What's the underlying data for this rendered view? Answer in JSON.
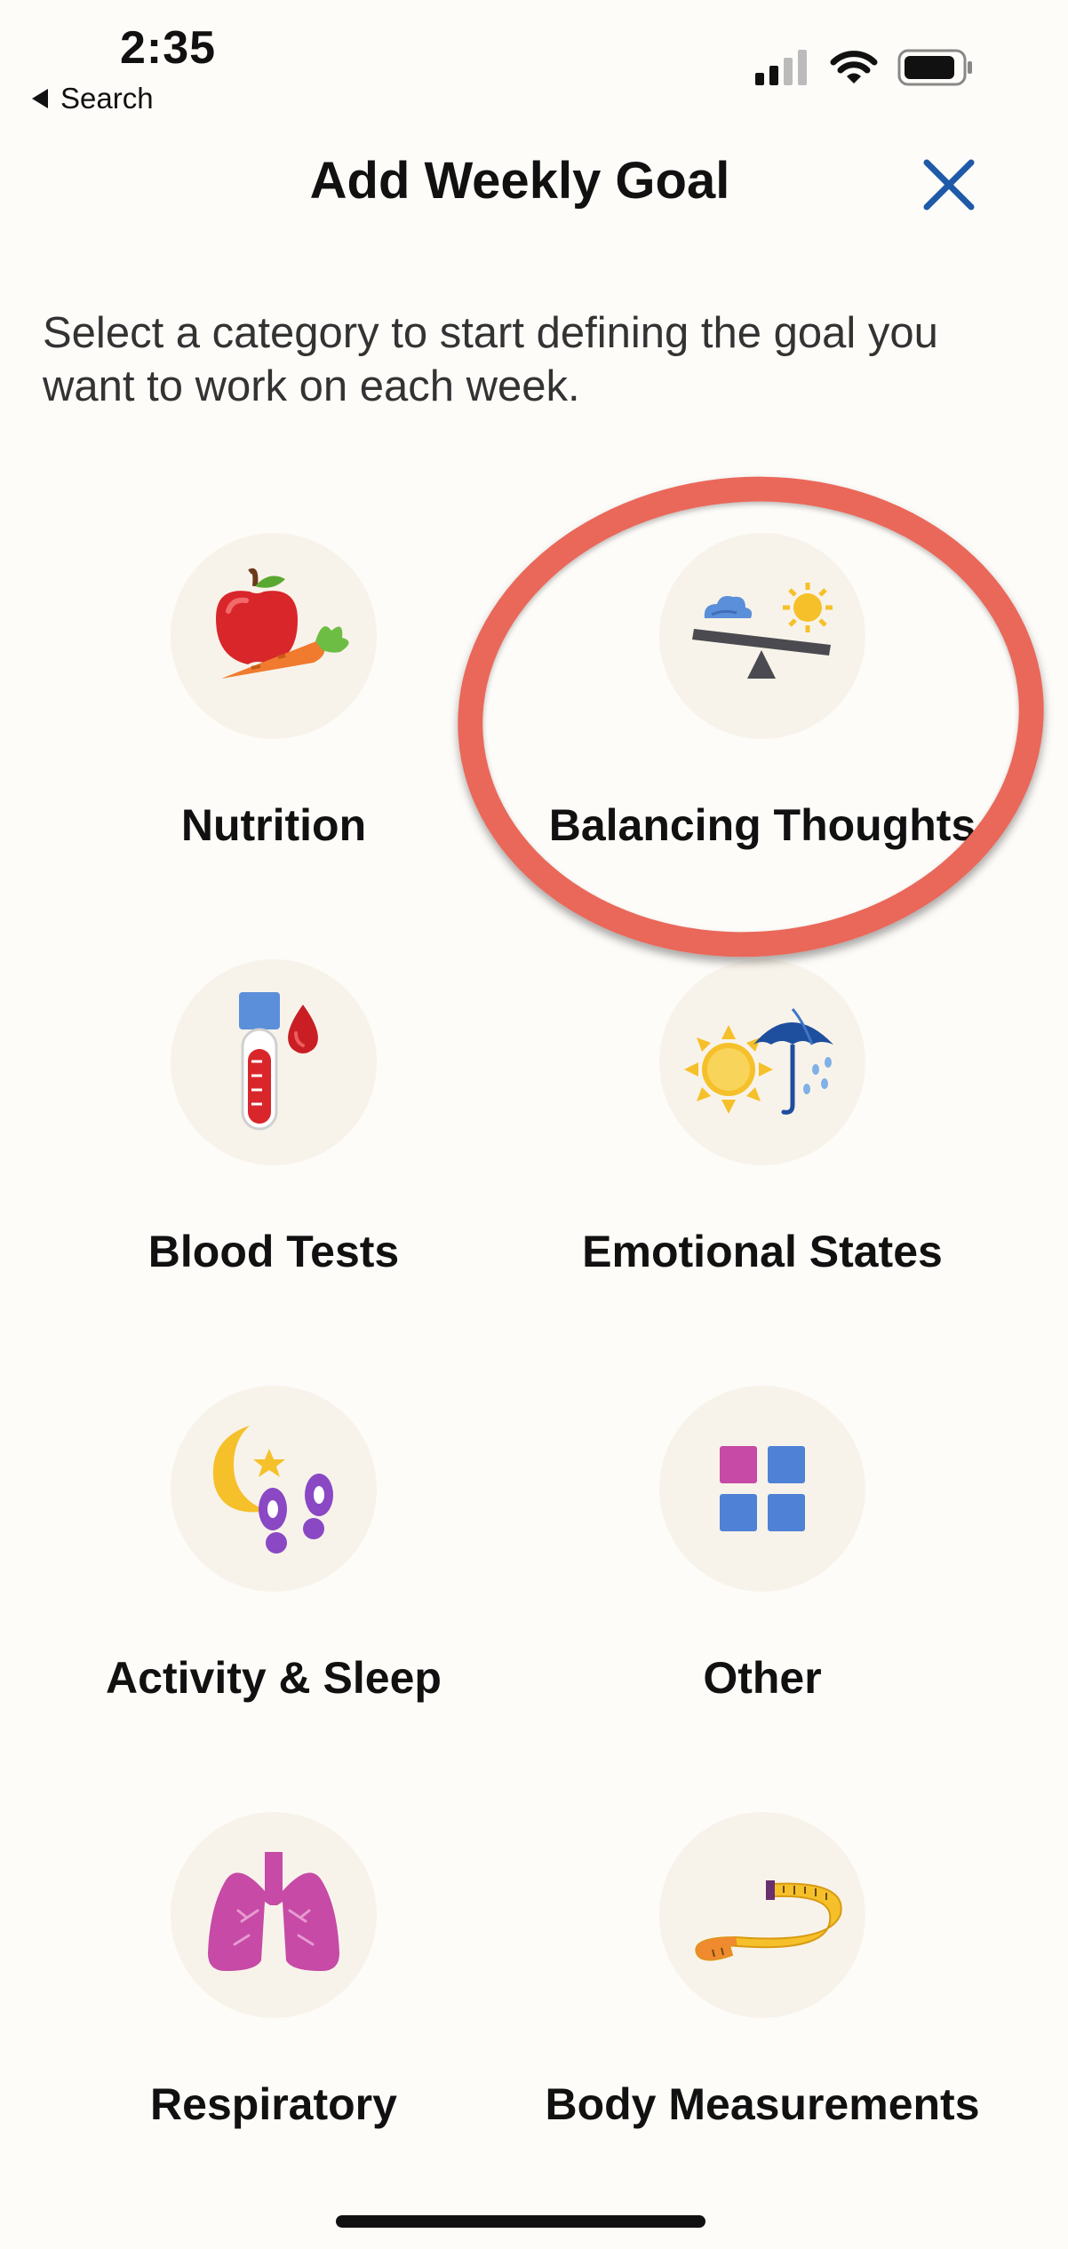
{
  "status_bar": {
    "time": "2:35",
    "back_label": "Search",
    "icons": [
      "cellular-signal-icon",
      "wifi-icon",
      "battery-icon"
    ]
  },
  "header": {
    "title": "Add Weekly Goal",
    "close_icon": "close-icon"
  },
  "intro_text": "Select a category to start defining the goal you want to work on each week.",
  "categories": [
    {
      "label": "Nutrition",
      "icon": "apple-carrot-icon"
    },
    {
      "label": "Balancing Thoughts",
      "icon": "seesaw-icon",
      "highlighted": true
    },
    {
      "label": "Blood Tests",
      "icon": "test-tube-icon"
    },
    {
      "label": "Emotional States",
      "icon": "sun-umbrella-icon"
    },
    {
      "label": "Activity & Sleep",
      "icon": "moon-footprints-icon"
    },
    {
      "label": "Other",
      "icon": "grid-squares-icon"
    },
    {
      "label": "Respiratory",
      "icon": "lungs-icon"
    },
    {
      "label": "Body Measurements",
      "icon": "measuring-tape-icon"
    }
  ],
  "colors": {
    "background": "#fefcf9",
    "icon_circle": "#f8f3ea",
    "close_icon": "#1e5aa8",
    "highlight_ring": "#e9685a"
  }
}
